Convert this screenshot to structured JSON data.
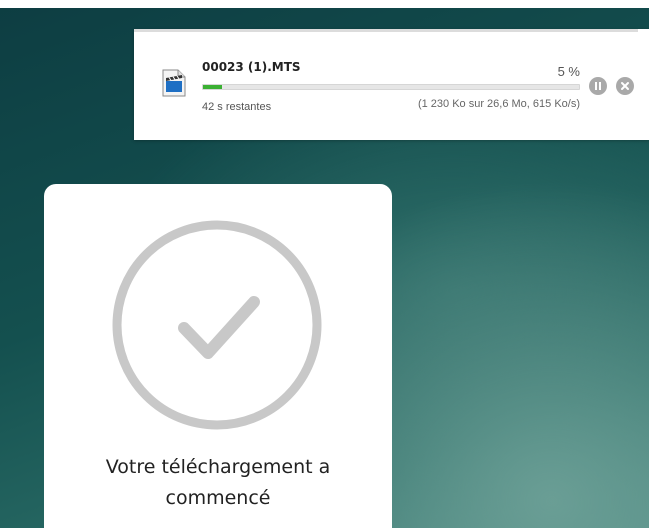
{
  "download": {
    "file_name": "00023 (1).MTS",
    "percent_label": "5 %",
    "progress_fraction": 0.05,
    "time_remaining": "42 s restantes",
    "details": "(1 230 Ko sur 26,6 Mo, 615 Ko/s)",
    "file_icon": "video-file-icon",
    "pause_icon": "pause-icon",
    "cancel_icon": "close-icon",
    "progress_color": "#3bb033"
  },
  "card": {
    "icon": "checkmark-circle-icon",
    "message_line1": "Votre téléchargement a",
    "message_line2": "commencé"
  },
  "colors": {
    "background": "#14504f",
    "icon_gray": "#a9a9a9"
  }
}
